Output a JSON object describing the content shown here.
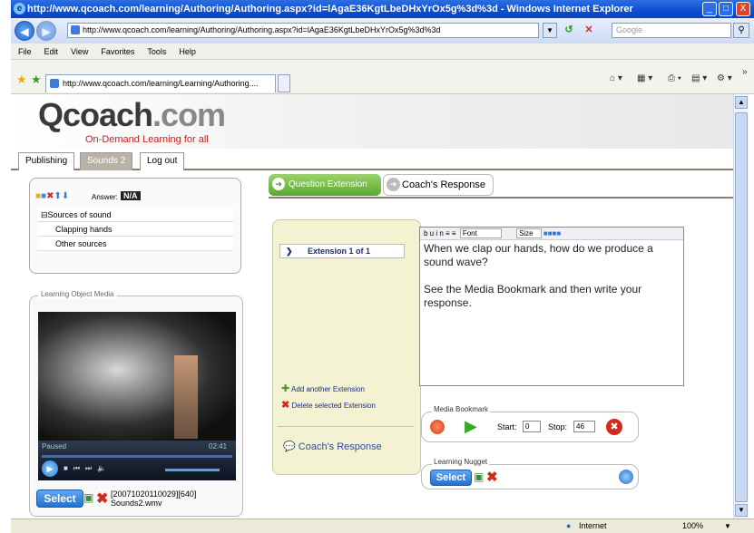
{
  "window": {
    "title": "http://www.qcoach.com/learning/Authoring/Authoring.aspx?id=lAgaE36KgtLbeDHxYrOx5g%3d%3d - Windows Internet Explorer",
    "min_label": "_",
    "max_label": "□",
    "close_label": "X"
  },
  "addressbar": {
    "url": "http://www.qcoach.com/learning/Authoring/Authoring.aspx?id=lAgaE36KgtLbeDHxYrOx5g%3d%3d",
    "search_placeholder": "Google"
  },
  "menu": [
    "File",
    "Edit",
    "View",
    "Favorites",
    "Tools",
    "Help"
  ],
  "browser_tab": {
    "label": "http://www.qcoach.com/learning/Learning/Authoring...."
  },
  "site": {
    "logo_main": "Qcoach",
    "logo_dot": ".com",
    "tagline": "On-Demand Learning for all"
  },
  "tabs": [
    "Publishing",
    "Sounds 2",
    "Log out"
  ],
  "tree": {
    "answer_label": "Answer:",
    "answer_value": "N/A",
    "root": "Sources of sound",
    "items": [
      "Clapping hands",
      "Other sources"
    ]
  },
  "media": {
    "section_label": "Learning Object Media",
    "status": "Paused",
    "time": "02:41",
    "select_label": "Select",
    "file_line1": "[20071020110029][640]",
    "file_line2": "Sounds2.wmv"
  },
  "main_tabs": {
    "question_extension": "Question Extension",
    "coach_response": "Coach's Response"
  },
  "extension": {
    "item": "Extension 1 of 1",
    "add_label": "Add another Extension",
    "delete_label": "Delete selected Extension",
    "coach_link": "Coach's Response"
  },
  "editor": {
    "font_label": "Font",
    "size_label": "Size",
    "text_line1": "When we clap our hands, how do we produce a sound wave?",
    "text_line2": "See the Media Bookmark and then write your response."
  },
  "bookmark": {
    "label": "Media Bookmark",
    "start_label": "Start:",
    "start_value": "0",
    "stop_label": "Stop:",
    "stop_value": "46"
  },
  "nugget": {
    "label": "Learning Nugget",
    "select_label": "Select"
  },
  "status": {
    "zone": "Internet",
    "zoom": "100%"
  }
}
